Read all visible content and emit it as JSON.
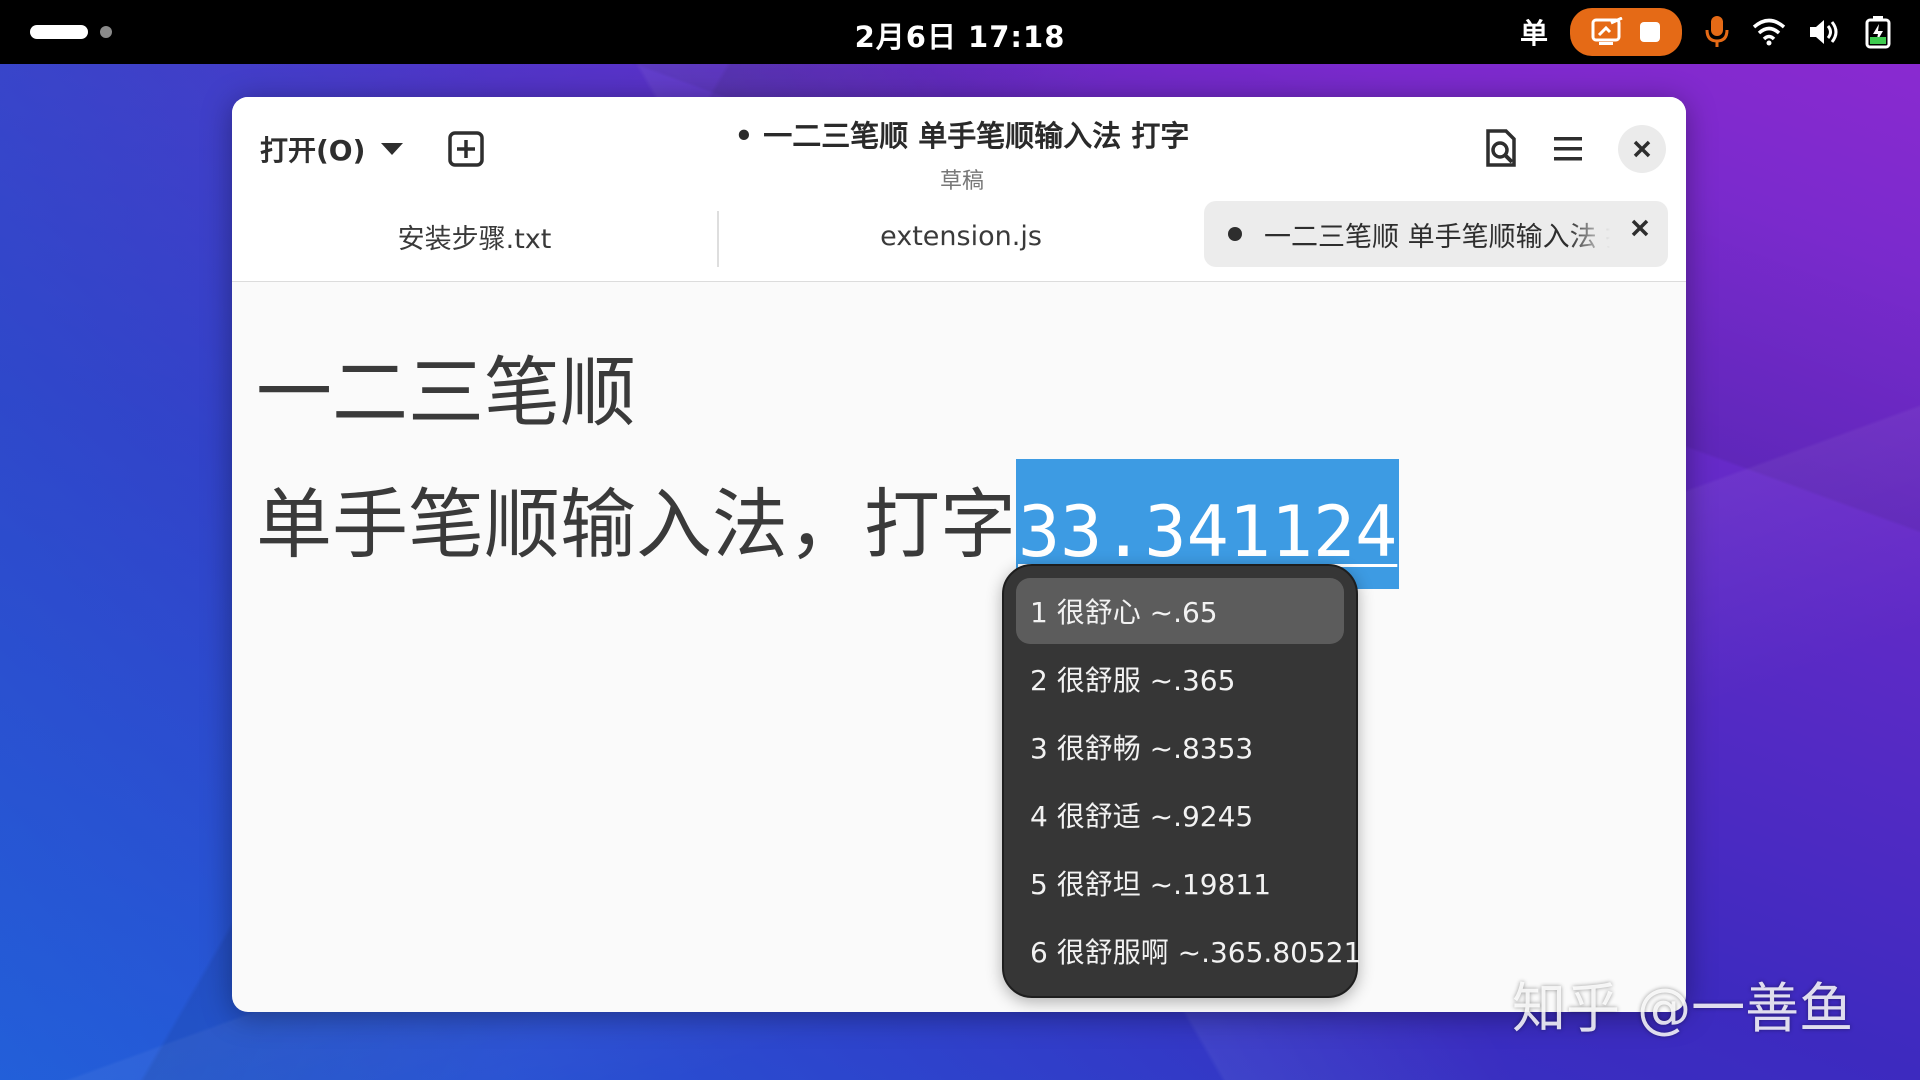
{
  "topbar": {
    "clock": "2月6日  17:18",
    "ime_indicator": "单",
    "icons": [
      "screen-record-icon",
      "stop-icon",
      "microphone-icon",
      "wifi-icon",
      "volume-icon",
      "battery-icon"
    ],
    "accent": "#e56a16"
  },
  "window": {
    "open_label": "打开(O)",
    "title": "• 一二三笔顺 单手笔顺输入法 打字",
    "subtitle": "草稿",
    "tabs": [
      {
        "label": "安装步骤.txt"
      },
      {
        "label": "extension.js"
      },
      {
        "label": "一二三笔顺 单手笔顺输入法 打字"
      }
    ]
  },
  "editor": {
    "line1": "一二三笔顺",
    "line2": "单手笔顺输入法，打字",
    "preedit": "33.341124",
    "selection_color": "#3d9be3"
  },
  "candidates": [
    "1 很舒心 ~.65",
    "2 很舒服 ~.365",
    "3 很舒畅 ~.8353",
    "4 很舒适 ~.9245",
    "5 很舒坦 ~.19811",
    "6 很舒服啊 ~.365.80521"
  ],
  "watermark": "知乎 @一善鱼"
}
